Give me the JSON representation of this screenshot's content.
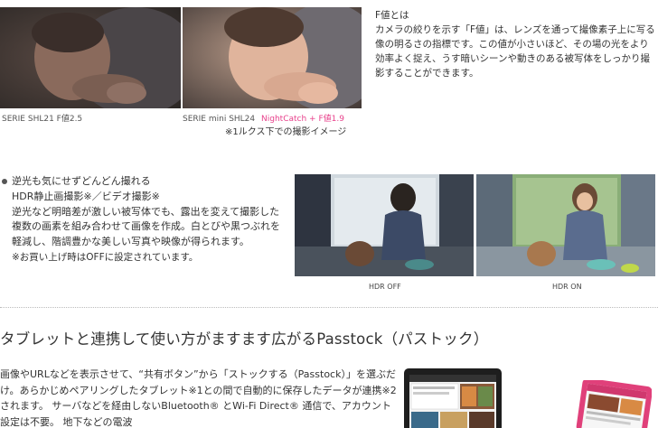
{
  "top_captions": {
    "left": "SERIE SHL21 F値2.5",
    "right_model": "SERIE mini SHL24",
    "right_highlight": "NightCatch + F値1.9",
    "note": "※1ルクス下での撮影イメージ"
  },
  "fvalue": {
    "title": "F値とは",
    "body": "カメラの絞りを示す「F値」は、レンズを通って撮像素子上に写る像の明るさの指標です。この値が小さいほど、その場の光をより効率よく捉え、うす暗いシーンや動きのある被写体をしっかり撮影することができます。"
  },
  "hdr": {
    "heading": "逆光も気にせずどんどん撮れる",
    "subheading": "HDR静止画撮影※／ビデオ撮影※",
    "body": "逆光など明暗差が激しい被写体でも、露出を変えて撮影した複数の画素を組み合わせて画像を作成。白とびや黒つぶれを軽減し、階調豊かな美しい写真や映像が得られます。",
    "note": "※お買い上げ時はOFFに設定されています。",
    "caption_off": "HDR OFF",
    "caption_on": "HDR ON"
  },
  "passtock": {
    "title": "タブレットと連携して使い方がますます広がるPasstock（パストック）",
    "body": "画像やURLなどを表示させて、“共有ボタン”から「ストックする（Passtock）」を選ぶだけ。あらかじめペアリングしたタブレット※1との間で自動的に保存したデータが連携※2されます。 サーバなどを経由しないBluetooth® とWi-Fi Direct® 通信で、アカウント設定は不要。 地下などの電波"
  },
  "colors": {
    "accent_pink": "#e8428c",
    "text": "#333333",
    "tablet_pink": "#e0407a"
  },
  "icons": [
    "bullet-icon"
  ]
}
